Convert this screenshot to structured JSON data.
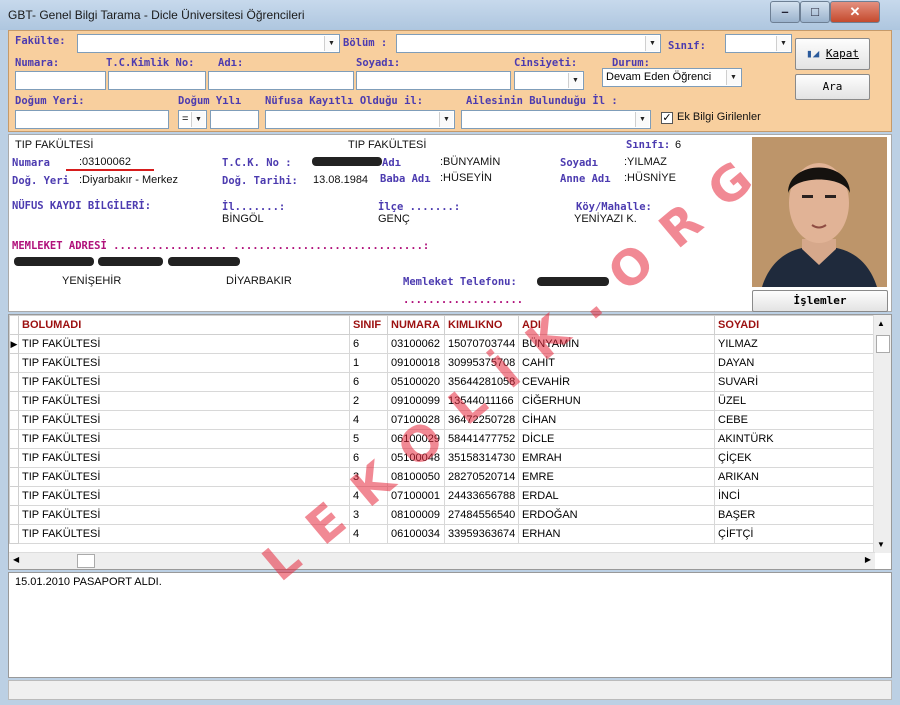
{
  "window": {
    "title": "GBT- Genel Bilgi Tarama - Dicle Üniversitesi Öğrencileri",
    "controls": {
      "minimize": "–",
      "maximize": "□",
      "close": "✕"
    }
  },
  "filters": {
    "fakulte_label": "Fakülte:",
    "bolum_label": "Bölüm :",
    "sinif_label": "Sınıf:",
    "numara_label": "Numara:",
    "tckimlik_label": "T.C.Kimlik No:",
    "adi_label": "Adı:",
    "soyadi_label": "Soyadı:",
    "cinsiyeti_label": "Cinsiyeti:",
    "durum_label": "Durum:",
    "durum_value": "Devam Eden Öğrenci",
    "dogum_yeri_label": "Doğum Yeri:",
    "dogum_yili_label": "Doğum Yılı",
    "dogum_yili_op": "=",
    "nufus_label": "Nüfusa Kayıtlı Olduğu il:",
    "aile_label": "Ailesinin Bulunduğu İl :",
    "ek_bilgi_label": "Ek Bilgi Girilenler",
    "ek_bilgi_checked": "✓",
    "kapat_label": "Kapat",
    "ara_label": "Ara"
  },
  "student": {
    "fakulte1": "TIP FAKÜLTESİ",
    "fakulte2": "TIP FAKÜLTESİ",
    "sinif_label": "Sınıfı:",
    "sinif": "6",
    "numara_label": "Numara",
    "numara": ":03100062",
    "tck_label": "T.C.K. No :",
    "adi_label": "Adı",
    "adi": ":BÜNYAMİN",
    "soyadi_label": "Soyadı",
    "soyadi": ":YILMAZ",
    "dog_yeri_label": "Doğ. Yeri",
    "dog_yeri": ":Diyarbakır - Merkez",
    "dog_tarihi_label": "Doğ. Tarihi:",
    "dog_tarihi": "13.08.1984",
    "baba_label": "Baba Adı",
    "baba": ":HÜSEYİN",
    "anne_label": "Anne Adı",
    "anne": ":HÜSNİYE",
    "nufus_header": "NÜFUS KAYDI BİLGİLERİ:",
    "il_label": "İl.......:",
    "il": "BİNGÖL",
    "ilce_label": "İlçe .......:",
    "ilce": "GENÇ",
    "koy_label": "Köy/Mahalle:",
    "koy": "YENİYAZI K.",
    "memleket_label": "MEMLEKET ADRESİ .................. ..............................:",
    "mem_ilce": "YENİŞEHİR",
    "mem_il": "DİYARBAKIR",
    "mem_tel_label": "Memleket Telefonu:",
    "dots": "...................",
    "islemler_label": "İşlemler"
  },
  "table": {
    "columns": [
      "BOLUMADI",
      "SINIF",
      "NUMARA",
      "KIMLIKNO",
      "ADI",
      "SOYADI"
    ],
    "rows": [
      [
        "TIP FAKÜLTESİ",
        "6",
        "03100062",
        "15070703744",
        "BÜNYAMİN",
        "YILMAZ"
      ],
      [
        "TIP FAKÜLTESİ",
        "1",
        "09100018",
        "30995375708",
        "CAHİT",
        "DAYAN"
      ],
      [
        "TIP FAKÜLTESİ",
        "6",
        "05100020",
        "35644281058",
        "CEVAHİR",
        "SUVARİ"
      ],
      [
        "TIP FAKÜLTESİ",
        "2",
        "09100099",
        "13544011166",
        "CİĞERHUN",
        "ÜZEL"
      ],
      [
        "TIP FAKÜLTESİ",
        "4",
        "07100028",
        "36472250728",
        "CİHAN",
        "CEBE"
      ],
      [
        "TIP FAKÜLTESİ",
        "5",
        "06100029",
        "58441477752",
        "DİCLE",
        "AKINTÜRK"
      ],
      [
        "TIP FAKÜLTESİ",
        "6",
        "05100048",
        "35158314730",
        "EMRAH",
        "ÇİÇEK"
      ],
      [
        "TIP FAKÜLTESİ",
        "3",
        "08100050",
        "28270520714",
        "EMRE",
        "ARIKAN"
      ],
      [
        "TIP FAKÜLTESİ",
        "4",
        "07100001",
        "24433656788",
        "ERDAL",
        "İNCİ"
      ],
      [
        "TIP FAKÜLTESİ",
        "3",
        "08100009",
        "27484556540",
        "ERDOĞAN",
        "BAŞER"
      ],
      [
        "TIP FAKÜLTESİ",
        "4",
        "06100034",
        "33959363674",
        "ERHAN",
        "ÇİFTÇİ"
      ]
    ]
  },
  "notes": {
    "text": "15.01.2010 PASAPORT ALDI."
  },
  "watermark": {
    "text": "LEKOLİK.ORG"
  },
  "colors": {
    "filter_bg": "#f8cf9e",
    "label": "#4c3bb0",
    "header_text": "#9c1010"
  }
}
